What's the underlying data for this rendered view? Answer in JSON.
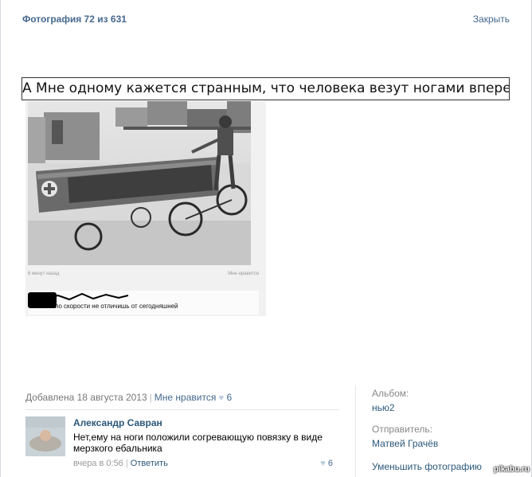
{
  "header": {
    "photo_counter": "Фотография 72 из 631",
    "close_label": "Закрыть"
  },
  "photo": {
    "caption": "А Мне одному кажется странным, что человека везут ногами вперед?",
    "meta_time": "6 минут назад",
    "meta_likes": "Мне нравится",
    "comment_text": "по скорости не отличишь от сегодняшней"
  },
  "info": {
    "added_label": "Добавлена 18 августа 2013",
    "like_label": "Мне нравится",
    "like_count": "6"
  },
  "comment": {
    "author": "Александр Савран",
    "text": "Нет,ему на ноги положили согревающую повязку в виде мерзкого ебальника",
    "time": "вчера в 0:56",
    "reply_label": "Ответить",
    "like_count": "6"
  },
  "sidebar": {
    "album_label": "Альбом:",
    "album_value": "нью2",
    "sender_label": "Отправитель:",
    "sender_value": "Матвей Грачёв",
    "reduce_label": "Уменьшить фотографию"
  },
  "watermark": "pikabu.ru",
  "colors": {
    "link": "#45688e",
    "author": "#2b587a",
    "muted": "#777777"
  }
}
